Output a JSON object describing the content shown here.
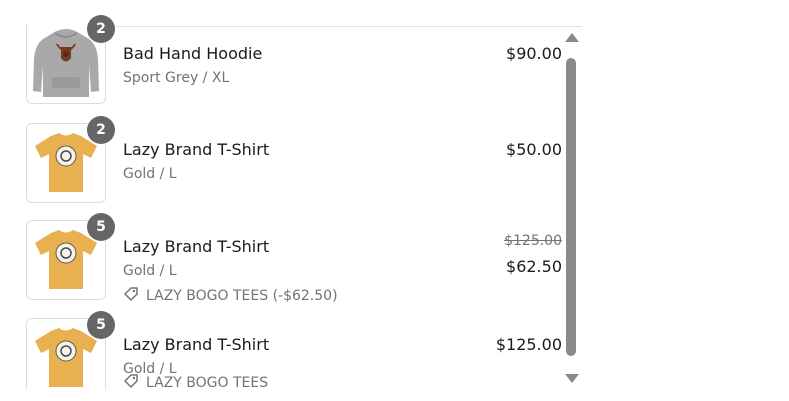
{
  "colors": {
    "badge": "#666666",
    "text_primary": "#1a1a1a",
    "text_secondary": "#737373",
    "scrollbar": "#8a8a8a",
    "hoodie": "#a9a9a9",
    "tshirt": "#e8b04f"
  },
  "items": [
    {
      "quantity": "2",
      "title": "Bad Hand Hoodie",
      "variant": "Sport Grey / XL",
      "price": "$90.00",
      "image_icon": "hoodie-image"
    },
    {
      "quantity": "2",
      "title": "Lazy Brand T-Shirt",
      "variant": "Gold / L",
      "price": "$50.00",
      "image_icon": "tshirt-image"
    },
    {
      "quantity": "5",
      "title": "Lazy Brand T-Shirt",
      "variant": "Gold / L",
      "original_price": "$125.00",
      "price": "$62.50",
      "discount": "LAZY BOGO TEES (-$62.50)",
      "image_icon": "tshirt-image"
    },
    {
      "quantity": "5",
      "title": "Lazy Brand T-Shirt",
      "variant": "Gold / L",
      "price": "$125.00",
      "discount": "LAZY BOGO TEES",
      "image_icon": "tshirt-image"
    }
  ]
}
